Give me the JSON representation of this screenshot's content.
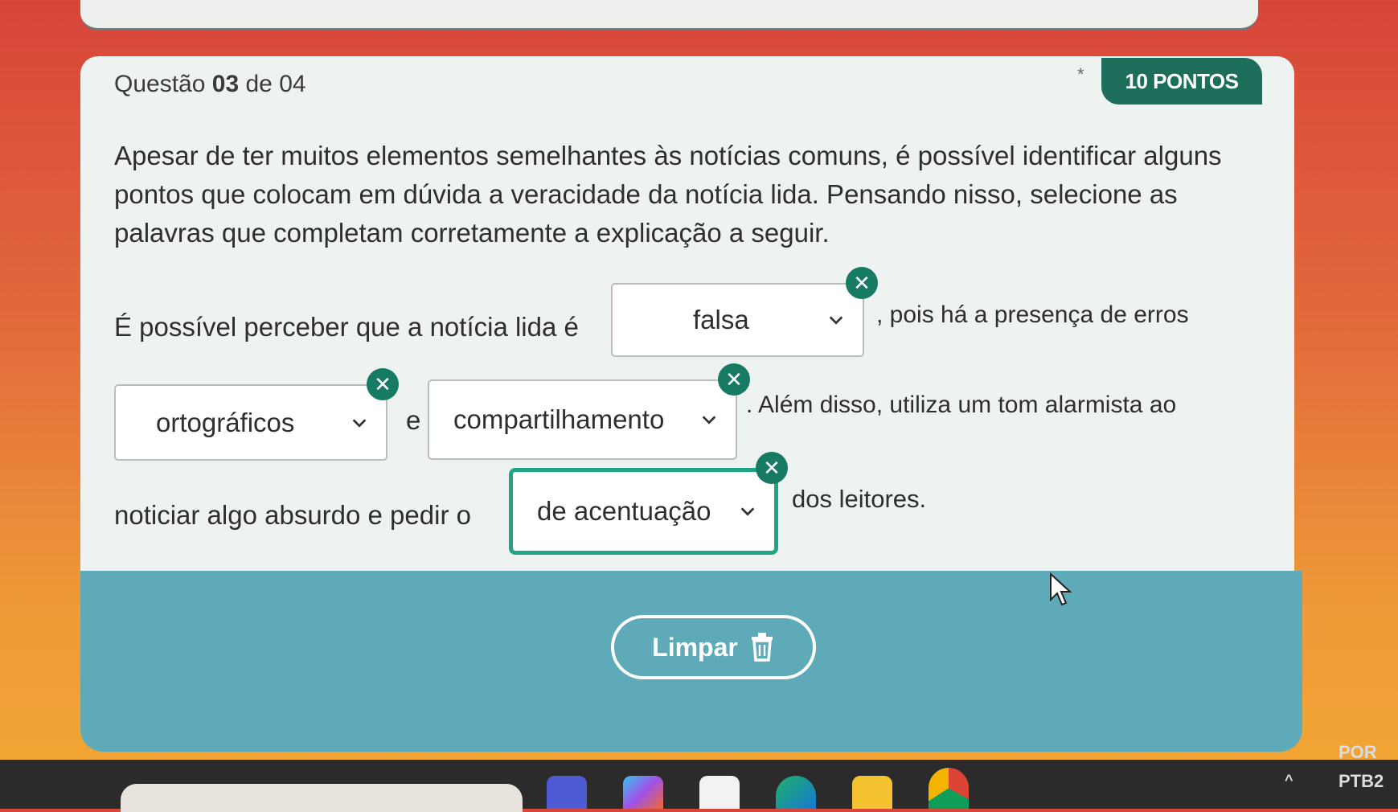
{
  "question": {
    "label_prefix": "Questão",
    "number": "03",
    "label_suffix": "de 04",
    "points": "10 PONTOS",
    "prompt": "Apesar de ter muitos elementos semelhantes às notícias comuns, é possível identificar alguns pontos que colocam em dúvida a veracidade da notícia lida. Pensando nisso, selecione as palavras que completam corretamente a explicação a seguir."
  },
  "sentence": {
    "part1": "É possível perceber que a notícia lida é",
    "part2": ", pois há a presença de erros",
    "part3": "e",
    "part4": ". Além disso, utiliza um tom alarmista ao",
    "part5": "noticiar algo absurdo e pedir o",
    "part6": "dos leitores."
  },
  "dropdowns": [
    {
      "selected": "falsa"
    },
    {
      "selected": "ortográficos"
    },
    {
      "selected": "compartilhamento"
    },
    {
      "selected": "de acentuação"
    }
  ],
  "actions": {
    "clear_label": "Limpar"
  },
  "tray": {
    "language": "POR",
    "layout": "PTB2"
  },
  "colors": {
    "accent": "#177a62",
    "badge": "#1d6e5a",
    "footer": "#5eaab9",
    "active_border": "#1fa583"
  }
}
